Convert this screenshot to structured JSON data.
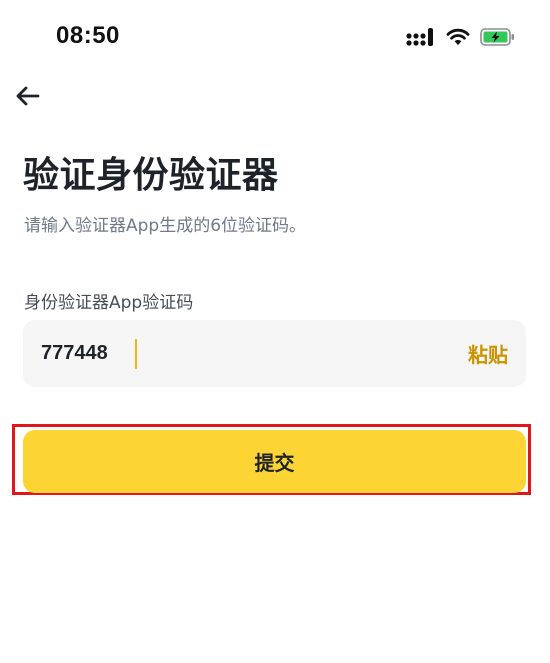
{
  "status_bar": {
    "time": "08:50",
    "icons": [
      "cellular-signal-icon",
      "wifi-icon",
      "battery-charging-icon"
    ],
    "colors": {
      "battery": "#34c759"
    }
  },
  "header": {
    "back_icon": "arrow-left-icon"
  },
  "page": {
    "title": "验证身份验证器",
    "subtitle": "请输入验证器App生成的6位验证码。"
  },
  "form": {
    "field_label": "身份验证器App验证码",
    "code_value": "777448",
    "paste_label": "粘贴",
    "submit_label": "提交"
  },
  "colors": {
    "accent": "#fcd535",
    "paste_text": "#c99400",
    "highlight_border": "#e0161b"
  }
}
